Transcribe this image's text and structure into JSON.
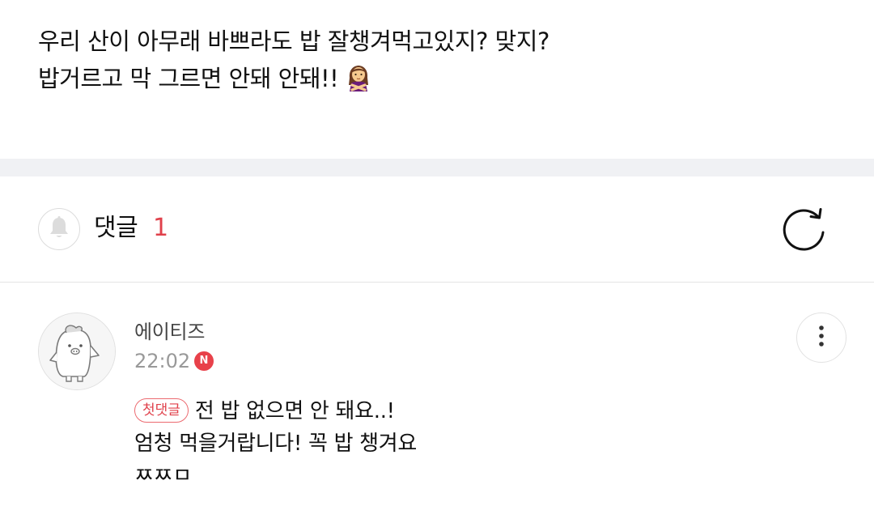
{
  "post": {
    "lines": [
      "우리 산이 아무래 바쁘라도 밥 잘챙겨먹고있지? 맞지?",
      "밥거르고 막 그르면 안돼 안돼!!"
    ],
    "emoji_icon": "woman-gesturing-no-emoji"
  },
  "comments_section": {
    "title": "댓글",
    "count": "1",
    "bell_icon": "bell-icon",
    "refresh_icon": "refresh-icon"
  },
  "comments": [
    {
      "author": "에이티즈",
      "time": "22:02",
      "new_badge": "N",
      "first_badge": "첫댓글",
      "lines": [
        "전 밥 없으면 안 돼요..!",
        "엄청 먹을거랍니다! 꼭 밥 챙겨요",
        "ㅉㅉㅁ"
      ],
      "avatar_icon": "ateez-character-avatar",
      "more_icon": "more-vertical-icon"
    }
  ],
  "colors": {
    "accent_red": "#e0414b",
    "divider_bg": "#f0f1f4",
    "muted_text": "#999999"
  }
}
